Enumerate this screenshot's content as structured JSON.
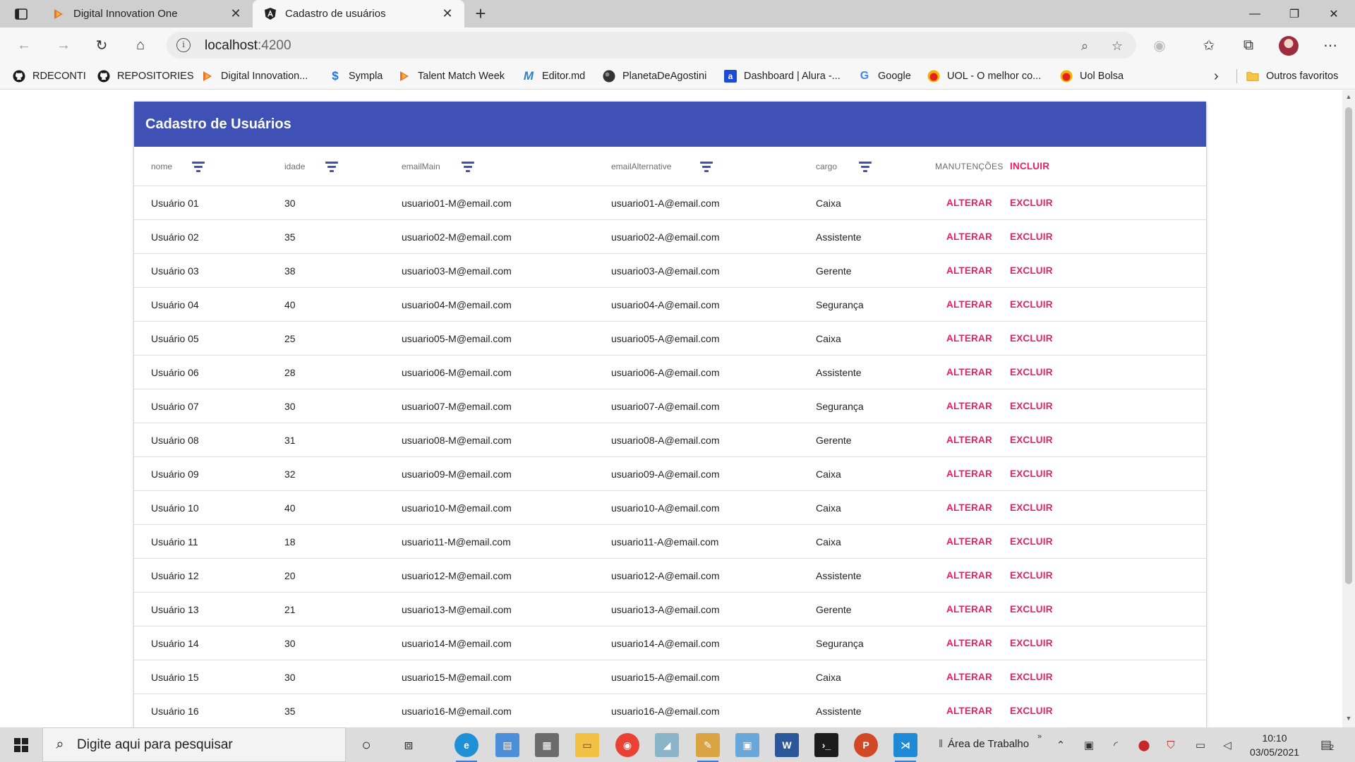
{
  "browser": {
    "tabs": [
      {
        "title": "Digital Innovation One"
      },
      {
        "title": "Cadastro de usuários"
      }
    ],
    "address": {
      "host": "localhost",
      "port": ":4200"
    },
    "bookmarks": [
      {
        "label": "RDECONTI",
        "icon": "github-icon"
      },
      {
        "label": "REPOSITORIES",
        "icon": "github-icon"
      },
      {
        "label": "Digital Innovation...",
        "icon": "dio-icon"
      },
      {
        "label": "Sympla",
        "icon": "sympla-icon"
      },
      {
        "label": "Talent Match Week",
        "icon": "dio-icon"
      },
      {
        "label": "Editor.md",
        "icon": "markdown-icon"
      },
      {
        "label": "PlanetaDeAgostini",
        "icon": "planeta-icon"
      },
      {
        "label": "Dashboard | Alura -...",
        "icon": "alura-icon"
      },
      {
        "label": "Google",
        "icon": "google-icon"
      },
      {
        "label": "UOL - O melhor co...",
        "icon": "uol-icon"
      },
      {
        "label": "Uol Bolsa",
        "icon": "uol-icon"
      }
    ],
    "other_favorites": "Outros favoritos"
  },
  "page": {
    "header_title": "Cadastro de Usuários",
    "columns": {
      "nome": "nome",
      "idade": "idade",
      "emailMain": "emailMain",
      "emailAlternative": "emailAlternative",
      "cargo": "cargo",
      "manutencoes": "MANUTENÇÕES",
      "incluir": "INCLUIR"
    },
    "actions": {
      "alterar": "ALTERAR",
      "excluir": "EXCLUIR"
    },
    "rows": [
      {
        "nome": "Usuário 01",
        "idade": "30",
        "emailMain": "usuario01-M@email.com",
        "emailAlternative": "usuario01-A@email.com",
        "cargo": "Caixa"
      },
      {
        "nome": "Usuário 02",
        "idade": "35",
        "emailMain": "usuario02-M@email.com",
        "emailAlternative": "usuario02-A@email.com",
        "cargo": "Assistente"
      },
      {
        "nome": "Usuário 03",
        "idade": "38",
        "emailMain": "usuario03-M@email.com",
        "emailAlternative": "usuario03-A@email.com",
        "cargo": "Gerente"
      },
      {
        "nome": "Usuário 04",
        "idade": "40",
        "emailMain": "usuario04-M@email.com",
        "emailAlternative": "usuario04-A@email.com",
        "cargo": "Segurança"
      },
      {
        "nome": "Usuário 05",
        "idade": "25",
        "emailMain": "usuario05-M@email.com",
        "emailAlternative": "usuario05-A@email.com",
        "cargo": "Caixa"
      },
      {
        "nome": "Usuário 06",
        "idade": "28",
        "emailMain": "usuario06-M@email.com",
        "emailAlternative": "usuario06-A@email.com",
        "cargo": "Assistente"
      },
      {
        "nome": "Usuário 07",
        "idade": "30",
        "emailMain": "usuario07-M@email.com",
        "emailAlternative": "usuario07-A@email.com",
        "cargo": "Segurança"
      },
      {
        "nome": "Usuário 08",
        "idade": "31",
        "emailMain": "usuario08-M@email.com",
        "emailAlternative": "usuario08-A@email.com",
        "cargo": "Gerente"
      },
      {
        "nome": "Usuário 09",
        "idade": "32",
        "emailMain": "usuario09-M@email.com",
        "emailAlternative": "usuario09-A@email.com",
        "cargo": "Caixa"
      },
      {
        "nome": "Usuário 10",
        "idade": "40",
        "emailMain": "usuario10-M@email.com",
        "emailAlternative": "usuario10-A@email.com",
        "cargo": "Caixa"
      },
      {
        "nome": "Usuário 11",
        "idade": "18",
        "emailMain": "usuario11-M@email.com",
        "emailAlternative": "usuario11-A@email.com",
        "cargo": "Caixa"
      },
      {
        "nome": "Usuário 12",
        "idade": "20",
        "emailMain": "usuario12-M@email.com",
        "emailAlternative": "usuario12-A@email.com",
        "cargo": "Assistente"
      },
      {
        "nome": "Usuário 13",
        "idade": "21",
        "emailMain": "usuario13-M@email.com",
        "emailAlternative": "usuario13-A@email.com",
        "cargo": "Gerente"
      },
      {
        "nome": "Usuário 14",
        "idade": "30",
        "emailMain": "usuario14-M@email.com",
        "emailAlternative": "usuario14-A@email.com",
        "cargo": "Segurança"
      },
      {
        "nome": "Usuário 15",
        "idade": "30",
        "emailMain": "usuario15-M@email.com",
        "emailAlternative": "usuario15-A@email.com",
        "cargo": "Caixa"
      },
      {
        "nome": "Usuário 16",
        "idade": "35",
        "emailMain": "usuario16-M@email.com",
        "emailAlternative": "usuario16-A@email.com",
        "cargo": "Assistente"
      }
    ]
  },
  "taskbar": {
    "search_placeholder": "Digite aqui para pesquisar",
    "desktop_label": "Área de Trabalho",
    "time": "10:10",
    "date": "03/05/2021",
    "notifications": "2"
  },
  "colors": {
    "header": "#3f51b5",
    "action": "#e91e63",
    "filter_icon": "#3f51b5"
  }
}
